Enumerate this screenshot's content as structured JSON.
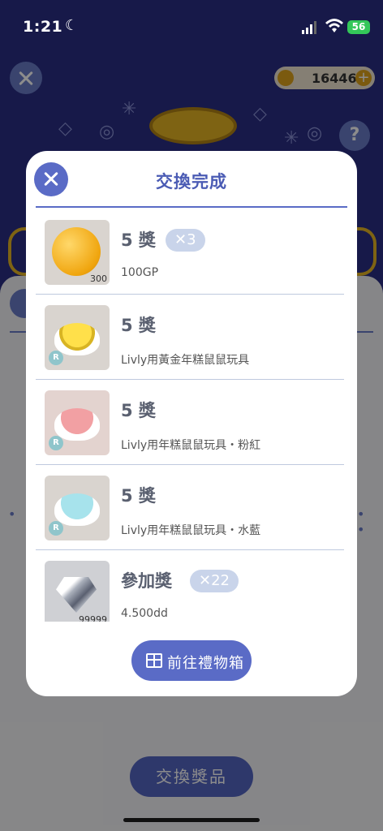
{
  "status_bar": {
    "time": "1:21",
    "battery": "56"
  },
  "header": {
    "coins": "16446",
    "help": "?"
  },
  "modal": {
    "title": "交換完成",
    "items": [
      {
        "qty": "5 獎",
        "mult": "✕3",
        "name": "100GP",
        "thumb_tag": "300",
        "rarity": ""
      },
      {
        "qty": "5 獎",
        "mult": "",
        "name": "Livly用黃金年糕鼠鼠玩具",
        "thumb_tag": "",
        "rarity": "R"
      },
      {
        "qty": "5 獎",
        "mult": "",
        "name": "Livly用年糕鼠鼠玩具・粉紅",
        "thumb_tag": "",
        "rarity": "R"
      },
      {
        "qty": "5 獎",
        "mult": "",
        "name": "Livly用年糕鼠鼠玩具・水藍",
        "thumb_tag": "",
        "rarity": "R"
      },
      {
        "qty": "參加獎",
        "mult": "✕22",
        "name": "4.500dd",
        "thumb_tag": "99999",
        "rarity": ""
      }
    ],
    "goto_button": "前往禮物箱"
  },
  "background": {
    "action_button": "交換獎品"
  },
  "colors": {
    "accent": "#5a6bc6",
    "title": "#4a5bb4",
    "badge": "#c9d4ea"
  }
}
